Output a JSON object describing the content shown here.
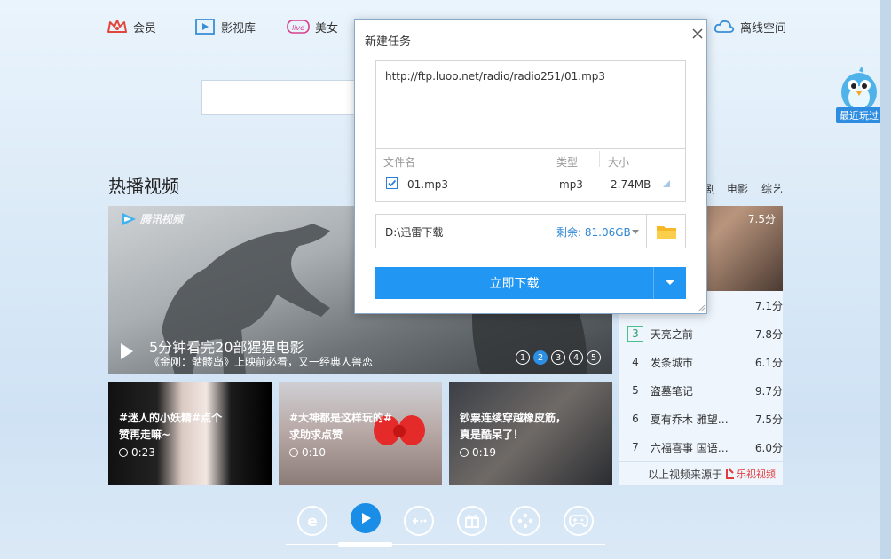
{
  "nav": {
    "items": [
      {
        "label": "会员",
        "icon": "crown-icon"
      },
      {
        "label": "影视库",
        "icon": "film-library-icon"
      },
      {
        "label": "美女",
        "icon": "live-icon"
      },
      {
        "label": "离线空间",
        "icon": "cloud-icon"
      }
    ]
  },
  "mascot": {
    "label": "最近玩过"
  },
  "hot": {
    "title": "热播视频",
    "tabs": [
      "剧",
      "电影",
      "综艺"
    ],
    "hero": {
      "logo": "腾讯视频",
      "title": "5分钟看完20部猩猩电影",
      "subtitle": "《金刚：骷髅岛》上映前必看，又一经典人兽恋",
      "pages": [
        "1",
        "2",
        "3",
        "4",
        "5"
      ],
      "active_page": "2"
    },
    "thumbs": [
      {
        "text": "#迷人的小妖精#点个赞再走嘛~",
        "duration": "0:23"
      },
      {
        "text": "#大神都是这样玩的#求助求点赞",
        "duration": "0:10"
      },
      {
        "text": "钞票连续穿越橡皮筋，真是酷呆了！",
        "duration": "0:19"
      }
    ]
  },
  "ranking": {
    "top_duration": "7.5分",
    "rows": [
      {
        "num": "",
        "name": "…",
        "score": "7.1分"
      },
      {
        "num": "3",
        "name": "天亮之前",
        "score": "7.8分"
      },
      {
        "num": "4",
        "name": "发条城市",
        "score": "6.1分"
      },
      {
        "num": "5",
        "name": "盗墓笔记",
        "score": "9.7分"
      },
      {
        "num": "6",
        "name": "夏有乔木 雅望…",
        "score": "7.5分"
      },
      {
        "num": "7",
        "name": "六福喜事 国语…",
        "score": "6.0分"
      }
    ],
    "source_label": "以上视频来源于",
    "source_brand": "乐视视频"
  },
  "dialog": {
    "title": "新建任务",
    "url": "http://ftp.luoo.net/radio/radio251/01.mp3",
    "columns": {
      "name": "文件名",
      "type": "类型",
      "size": "大小"
    },
    "file": {
      "name": "01.mp3",
      "type": "mp3",
      "size": "2.74MB",
      "checked": true
    },
    "path": "D:\\迅雷下载",
    "free_space": "剩余: 81.06GB",
    "download_label": "立即下载"
  },
  "dock": {
    "icons": [
      "ie-browser-icon",
      "play-icon",
      "game-controller-icon",
      "gift-icon",
      "apps-icon",
      "gamepad-icon"
    ],
    "active": 1
  },
  "colors": {
    "accent": "#2196f3",
    "free_space": "#2e86d4",
    "brand_red": "#e23b3b"
  }
}
